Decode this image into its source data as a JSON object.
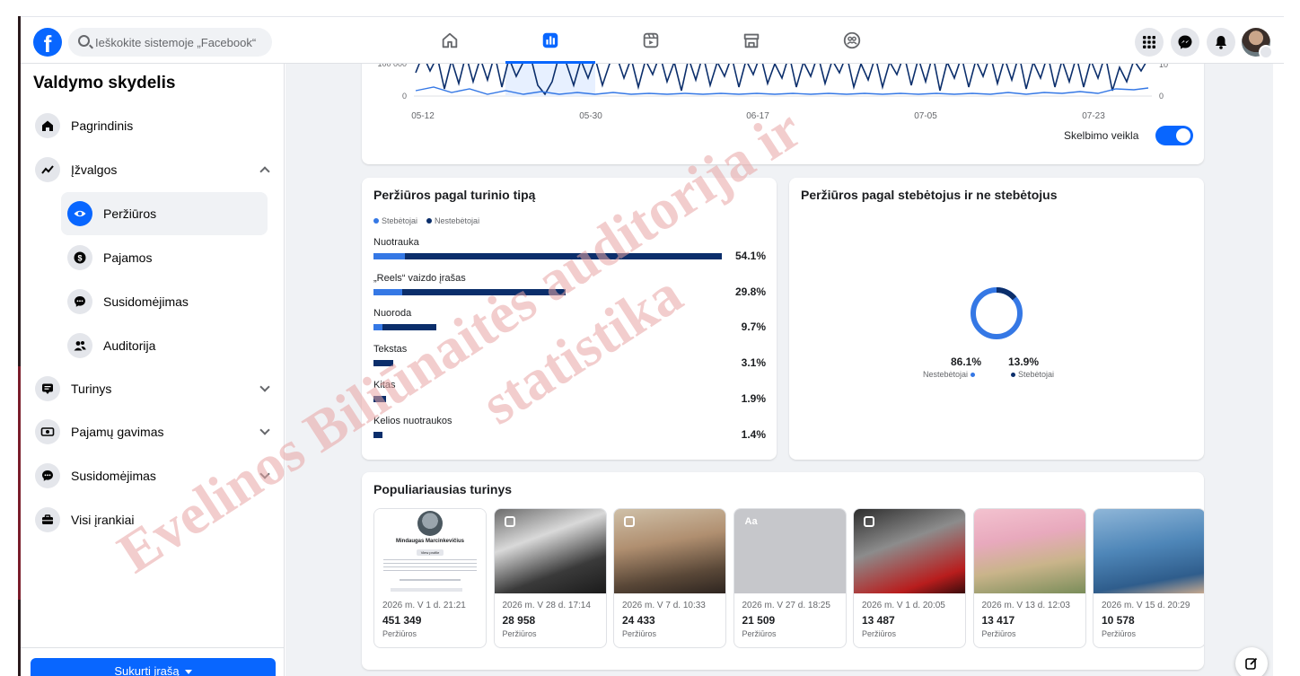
{
  "topbar": {
    "logo": "f",
    "search_placeholder": "Ieškokite sistemoje „Facebook“",
    "tabs": [
      {
        "icon": "home-icon"
      },
      {
        "icon": "insights-icon",
        "active": true
      },
      {
        "icon": "video-icon"
      },
      {
        "icon": "marketplace-icon"
      },
      {
        "icon": "groups-icon"
      }
    ],
    "right_icons": [
      "menu-grid-icon",
      "messenger-icon",
      "bell-icon",
      "avatar"
    ]
  },
  "sidebar": {
    "title": "Valdymo skydelis",
    "items": [
      {
        "label": "Pagrindinis",
        "icon": "home-icon"
      },
      {
        "label": "Įžvalgos",
        "icon": "trend-icon",
        "expanded": true
      },
      {
        "label": "Turinys",
        "icon": "content-icon"
      },
      {
        "label": "Pajamų gavimas",
        "icon": "money-icon"
      },
      {
        "label": "Susidomėjimas",
        "icon": "chat-icon"
      },
      {
        "label": "Visi įrankiai",
        "icon": "toolbox-icon"
      }
    ],
    "sub_items": [
      {
        "label": "Peržiūros",
        "icon": "eye-icon",
        "active": true
      },
      {
        "label": "Pajamos",
        "icon": "dollar-icon"
      },
      {
        "label": "Susidomėjimas",
        "icon": "chat-icon"
      },
      {
        "label": "Auditorija",
        "icon": "people-icon"
      }
    ],
    "create_button": "Sukurti įrašą"
  },
  "views_chart": {
    "y_left_ticks": [
      "100 000",
      "0"
    ],
    "y_right_ticks": [
      "10",
      "0"
    ],
    "x_ticks": [
      "05-12",
      "05-30",
      "06-17",
      "07-05",
      "07-23"
    ],
    "toggle_label": "Skelbimo veikla",
    "toggle_on": true
  },
  "chart_data": {
    "type": "bar",
    "title": "Peržiūros pagal turinio tipą",
    "legend": [
      "Stebėtojai",
      "Nestebėtojai"
    ],
    "legend_colors": [
      "#3578e5",
      "#0b2e6b"
    ],
    "categories": [
      "Nuotrauka",
      "„Reels“ vaizdo įrašas",
      "Nuoroda",
      "Tekstas",
      "Kitas",
      "Kelios nuotraukos"
    ],
    "values": [
      54.1,
      29.8,
      9.7,
      3.1,
      1.9,
      1.4
    ],
    "value_labels": [
      "54.1%",
      "29.8%",
      "9.7%",
      "3.1%",
      "1.9%",
      "1.4%"
    ],
    "followers_share": [
      0.09,
      0.15,
      0.15,
      0.0,
      0.0,
      0.0
    ]
  },
  "follower_split": {
    "title": "Peržiūros pagal stebėtojus ir ne stebėtojus",
    "non_followers": {
      "value": "86.1%",
      "label": "Nestebėtojai",
      "percent": 86.1,
      "color": "#3578e5"
    },
    "followers": {
      "value": "13.9%",
      "label": "Stebėtojai",
      "percent": 13.9,
      "color": "#0b2e6b"
    }
  },
  "popular": {
    "title": "Populiariausias turinys",
    "posts": [
      {
        "date": "2026 m. V 1 d. 21:21",
        "views": "451 349",
        "views_label": "Peržiūros",
        "kind": "profile",
        "profile_name": "Mindaugas Marcinkevičius",
        "profile_btn": "View profile"
      },
      {
        "date": "2026 m. V 28 d. 17:14",
        "views": "28 958",
        "views_label": "Peržiūros",
        "kind": "reel"
      },
      {
        "date": "2026 m. V 7 d. 10:33",
        "views": "24 433",
        "views_label": "Peržiūros",
        "kind": "reel"
      },
      {
        "date": "2026 m. V 27 d. 18:25",
        "views": "21 509",
        "views_label": "Peržiūros",
        "kind": "text",
        "badge": "Aa"
      },
      {
        "date": "2026 m. V 1 d. 20:05",
        "views": "13 487",
        "views_label": "Peržiūros",
        "kind": "reel"
      },
      {
        "date": "2026 m. V 13 d. 12:03",
        "views": "13 417",
        "views_label": "Peržiūros",
        "kind": "photo"
      },
      {
        "date": "2026 m. V 15 d. 20:29",
        "views": "10 578",
        "views_label": "Peržiūros",
        "kind": "photo"
      }
    ]
  },
  "watermark": {
    "lines": [
      "Evelinos Biliūnaitės auditorija ir",
      "statistika"
    ],
    "color": "#e8a5a5"
  }
}
